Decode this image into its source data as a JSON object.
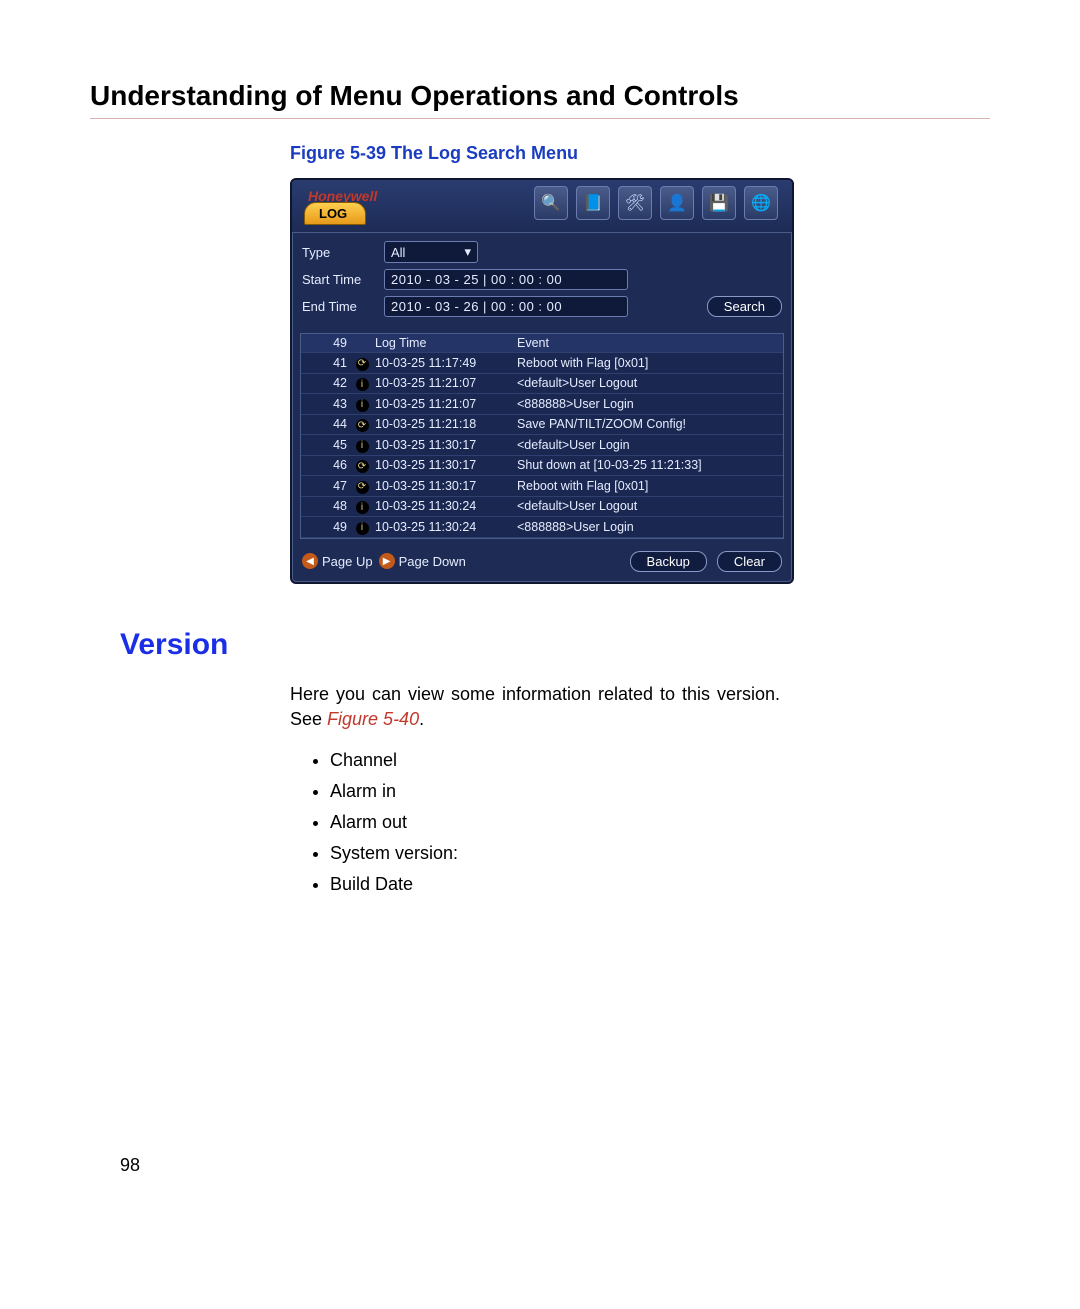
{
  "doc": {
    "page_title": "Understanding of Menu Operations and Controls",
    "figure_caption": "Figure 5-39 The Log Search Menu",
    "section_heading": "Version",
    "body_intro_pre": "Here you can view some information related to this version. See ",
    "body_intro_ref": "Figure 5-40",
    "body_intro_post": ".",
    "bullets": [
      "Channel",
      "Alarm in",
      "Alarm out",
      "System version:",
      "Build Date"
    ],
    "page_number": "98"
  },
  "ui": {
    "brand": "Honeywell",
    "tab_label": "LOG",
    "toolbar_icons": [
      "search-icon",
      "note-icon",
      "tools-icon",
      "user-icon",
      "disk-icon",
      "network-icon"
    ],
    "filters": {
      "type_label": "Type",
      "type_value": "All",
      "start_label": "Start Time",
      "start_value": "2010 - 03 - 25  | 00 : 00 : 00",
      "end_label": "End Time",
      "end_value": "2010 - 03 - 26  | 00 : 00 : 00",
      "search_label": "Search"
    },
    "list": {
      "count": "49",
      "col_time": "Log Time",
      "col_event": "Event",
      "rows": [
        {
          "n": "41",
          "icon": "sys",
          "time": "10-03-25 11:17:49",
          "event": "Reboot with Flag [0x01]"
        },
        {
          "n": "42",
          "icon": "info",
          "time": "10-03-25 11:21:07",
          "event": "<default>User Logout"
        },
        {
          "n": "43",
          "icon": "info",
          "time": "10-03-25 11:21:07",
          "event": "<888888>User Login"
        },
        {
          "n": "44",
          "icon": "sys",
          "time": "10-03-25 11:21:18",
          "event": "Save PAN/TILT/ZOOM Config!"
        },
        {
          "n": "45",
          "icon": "info",
          "time": "10-03-25 11:30:17",
          "event": "<default>User Login"
        },
        {
          "n": "46",
          "icon": "sys",
          "time": "10-03-25 11:30:17",
          "event": "Shut down at [10-03-25 11:21:33]"
        },
        {
          "n": "47",
          "icon": "sys",
          "time": "10-03-25 11:30:17",
          "event": "Reboot with Flag [0x01]"
        },
        {
          "n": "48",
          "icon": "info",
          "time": "10-03-25 11:30:24",
          "event": "<default>User Logout"
        },
        {
          "n": "49",
          "icon": "info",
          "time": "10-03-25 11:30:24",
          "event": "<888888>User Login"
        }
      ]
    },
    "footer": {
      "page_up": "Page Up",
      "page_down": "Page Down",
      "backup": "Backup",
      "clear": "Clear"
    }
  }
}
